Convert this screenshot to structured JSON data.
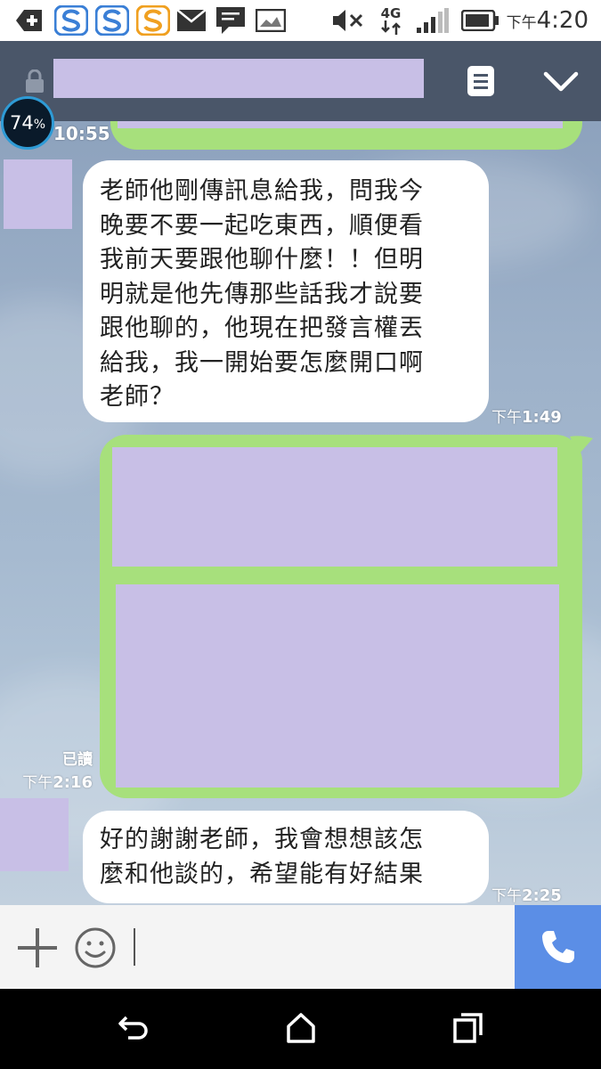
{
  "status_bar": {
    "time_prefix": "下午",
    "time": "4:20",
    "network": "4G"
  },
  "header": {
    "lock_icon": "lock-icon",
    "menu_icon": "notes-icon",
    "collapse_icon": "chevron-down-icon"
  },
  "overlay": {
    "battery_percent": "74",
    "percent_sign": "%"
  },
  "messages": [
    {
      "meta_time": "10:55"
    },
    {
      "side": "left",
      "text_lines": [
        "老師他剛傳訊息給我，問我今",
        "晚要不要一起吃東西，順便看",
        "我前天要跟他聊什麼！！但明",
        "明就是他先傳那些話我才說要",
        "跟他聊的，他現在把發言權丟",
        "給我，我一開始要怎麼開口啊",
        "老師？"
      ],
      "time_prefix": "下午",
      "time": "1:49"
    },
    {
      "side": "right",
      "read": "已讀",
      "time_prefix": "下午",
      "time": "2:16"
    },
    {
      "side": "left",
      "text_lines": [
        "好的謝謝老師，我會想想該怎",
        "麼和他談的，希望能有好結果"
      ],
      "time_prefix": "下午",
      "time": "2:25"
    }
  ],
  "input_bar": {
    "add_icon": "plus-icon",
    "emoji_icon": "emoji-icon",
    "call_icon": "phone-icon"
  },
  "nav_bar": {
    "back_icon": "back-icon",
    "home_icon": "home-icon",
    "recents_icon": "recents-icon"
  },
  "colors": {
    "header_bg": "#4a5669",
    "green_bubble": "#a7e07c",
    "redaction": "#c8bfe6",
    "call_button": "#5b8ee6"
  }
}
